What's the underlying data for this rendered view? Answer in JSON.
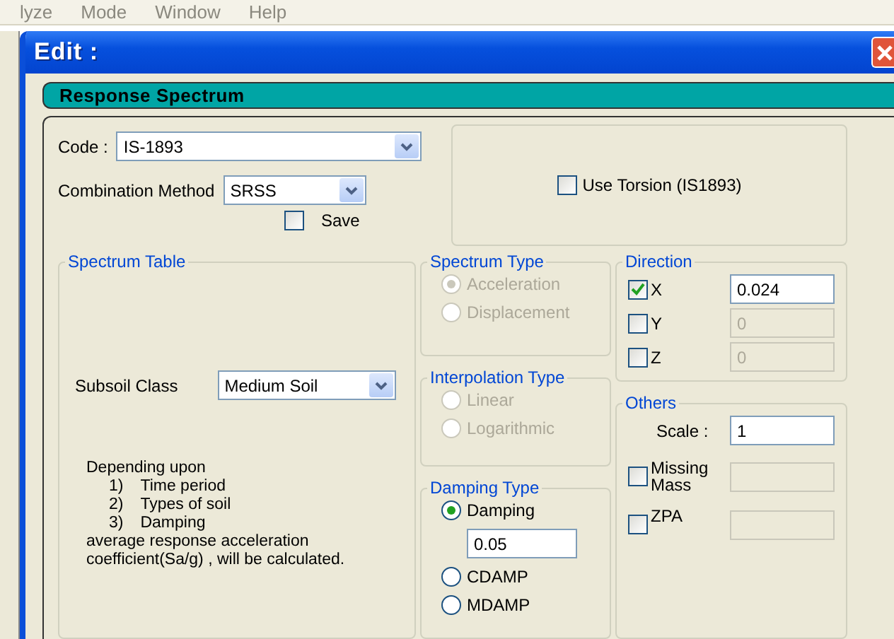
{
  "menu_bar": [
    "lyze",
    "Mode",
    "Window",
    "Help"
  ],
  "window": {
    "title": "Edit :"
  },
  "section_header": "Response Spectrum",
  "code": {
    "label": "Code :",
    "value": "IS-1893"
  },
  "combination_method": {
    "label": "Combination Method",
    "value": "SRSS"
  },
  "save": {
    "label": "Save",
    "checked": false
  },
  "use_torsion": {
    "label": "Use Torsion (IS1893)",
    "checked": false
  },
  "spectrum_table": {
    "title": "Spectrum Table",
    "subsoil_label": "Subsoil Class",
    "subsoil_value": "Medium Soil",
    "note_intro": "Depending upon",
    "note_items": [
      {
        "number": "1)",
        "text": "Time period"
      },
      {
        "number": "2)",
        "text": "Types of soil"
      },
      {
        "number": "3)",
        "text": "Damping"
      }
    ],
    "note_lines": [
      "average response acceleration",
      "coefficient(Sa/g) , will be calculated."
    ]
  },
  "spectrum_type": {
    "title": "Spectrum Type",
    "disabled": true,
    "options": [
      {
        "label": "Acceleration",
        "selected": true
      },
      {
        "label": "Displacement",
        "selected": false
      }
    ]
  },
  "interpolation_type": {
    "title": "Interpolation Type",
    "disabled": true,
    "options": [
      {
        "label": "Linear",
        "selected": false
      },
      {
        "label": "Logarithmic",
        "selected": false
      }
    ]
  },
  "damping_type": {
    "title": "Damping Type",
    "disabled": false,
    "options": [
      {
        "label": "Damping",
        "selected": true,
        "value": "0.05"
      },
      {
        "label": "CDAMP",
        "selected": false
      },
      {
        "label": "MDAMP",
        "selected": false
      }
    ]
  },
  "direction": {
    "title": "Direction",
    "items": [
      {
        "label": "X",
        "checked": true,
        "value": "0.024"
      },
      {
        "label": "Y",
        "checked": false,
        "value": "0"
      },
      {
        "label": "Z",
        "checked": false,
        "value": "0"
      }
    ]
  },
  "others": {
    "title": "Others",
    "scale_label": "Scale :",
    "scale_value": "1",
    "items": [
      {
        "label": "Missing Mass",
        "checked": false
      },
      {
        "label": "ZPA",
        "checked": false
      }
    ]
  }
}
